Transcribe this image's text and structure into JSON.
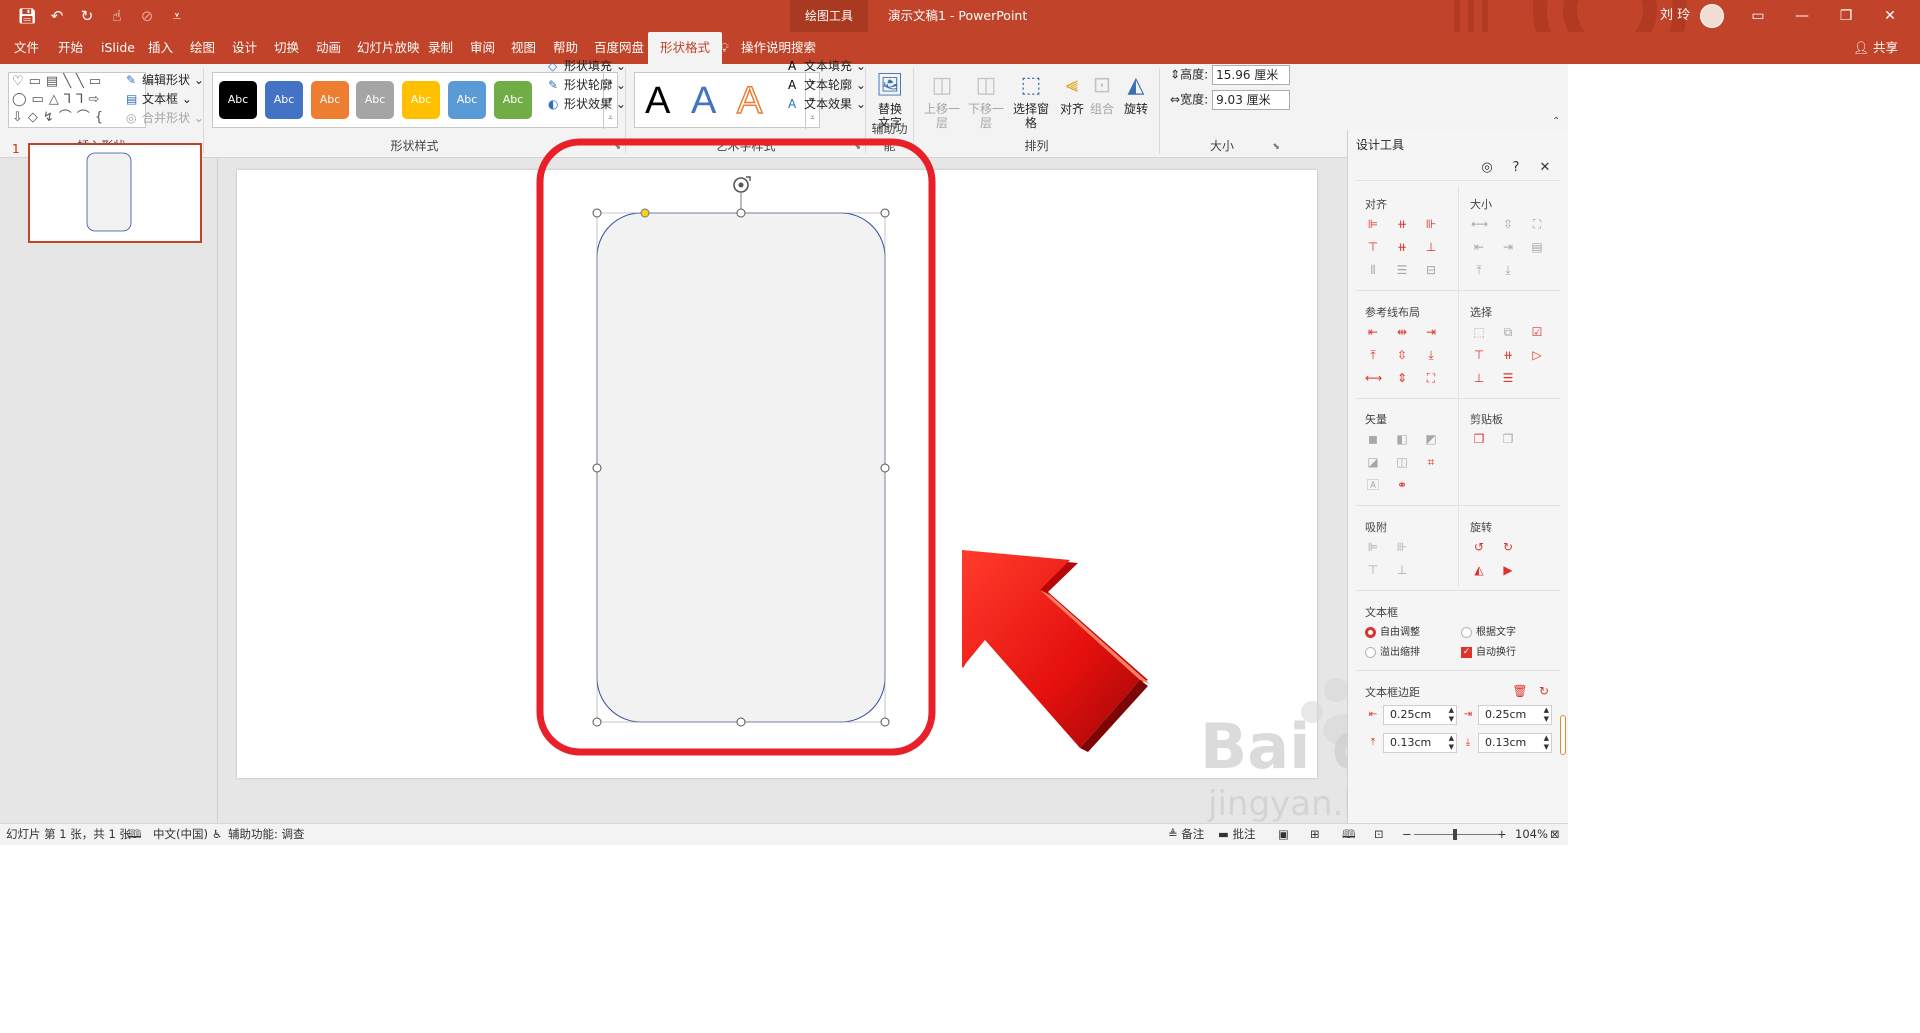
{
  "titlebar": {
    "context_tab": "绘图工具",
    "document_title": "演示文稿1  -  PowerPoint",
    "user_name": "刘 玲",
    "qat": [
      "save-icon",
      "undo-icon",
      "redo-icon",
      "touch-mode-icon",
      "format-painter-icon",
      "customize-icon"
    ]
  },
  "tabs": [
    "文件",
    "开始",
    "iSlide",
    "插入",
    "绘图",
    "设计",
    "切换",
    "动画",
    "幻灯片放映",
    "录制",
    "审阅",
    "视图",
    "帮助",
    "百度网盘",
    "形状格式"
  ],
  "tell_me": "操作说明搜索",
  "share": "共享",
  "ribbon": {
    "insert_shapes": {
      "label": "插入形状",
      "edit_shape": "编辑形状",
      "text_box": "文本框",
      "merge_shapes": "合并形状"
    },
    "shape_styles": {
      "label": "形状样式",
      "swatch_text": "Abc",
      "swatch_colors": [
        "#000000",
        "#4472c4",
        "#ed7d31",
        "#a5a5a5",
        "#ffc000",
        "#5b9bd5",
        "#70ad47"
      ],
      "fill": "形状填充",
      "outline": "形状轮廓",
      "effects": "形状效果"
    },
    "wordart": {
      "label": "艺术字样式",
      "letter": "A",
      "text_fill": "文本填充",
      "text_outline": "文本轮廓",
      "text_effects": "文本效果"
    },
    "accessibility": {
      "label": "辅助功能",
      "alt_text": "替换文字"
    },
    "arrange": {
      "label": "排列",
      "bring_forward": "上移一层",
      "send_backward": "下移一层",
      "selection_pane": "选择窗格",
      "align": "对齐",
      "group": "组合",
      "rotate": "旋转"
    },
    "size": {
      "label": "大小",
      "height_label": "高度:",
      "height_value": "15.96 厘米",
      "width_label": "宽度:",
      "width_value": "9.03 厘米"
    }
  },
  "thumbnails": {
    "slide_number": "1"
  },
  "panel": {
    "title": "设计工具",
    "sections": {
      "align": "对齐",
      "size": "大小",
      "guides": "参考线布局",
      "select": "选择",
      "vector": "矢量",
      "clipboard": "剪贴板",
      "snap": "吸附",
      "rotate": "旋转",
      "textbox": "文本框",
      "margins": "文本框边距"
    },
    "textbox_options": {
      "free_adjust": "自由调整",
      "fit_text": "根据文字",
      "overflow_shrink": "溢出缩排",
      "auto_wrap": "自动换行"
    },
    "margins": {
      "left": "0.25cm",
      "right": "0.25cm",
      "top": "0.13cm",
      "bottom": "0.13cm"
    }
  },
  "statusbar": {
    "slide_info": "幻灯片 第 1 张，共 1 张",
    "language": "中文(中国)",
    "accessibility": "辅助功能: 调查",
    "notes": "备注",
    "comments": "批注",
    "zoom": "104%"
  },
  "watermark": {
    "brand": "Bai du 经验",
    "url": "jingyan.baidu.com"
  },
  "colors": {
    "accent": "#c0432a",
    "highlight_red": "#e8202a",
    "panel_icon_red": "#e0322d",
    "shape_fill": "#f2f2f2",
    "shape_outline": "#2f4f9a"
  }
}
